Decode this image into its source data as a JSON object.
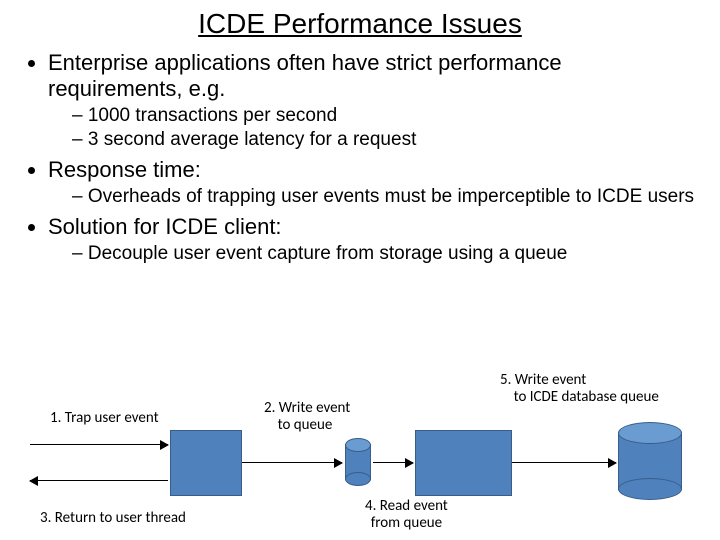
{
  "title": "ICDE Performance Issues",
  "bullets": {
    "b1": "Enterprise applications often have strict performance requirements, e.g.",
    "b1_1": "1000 transactions per second",
    "b1_2": "3 second average latency for a request",
    "b2": "Response time:",
    "b2_1": "Overheads of trapping user events must be imperceptible to ICDE users",
    "b3": "Solution for ICDE client:",
    "b3_1": "Decouple user event capture from storage using a queue"
  },
  "diagram": {
    "step1": "1. Trap user event",
    "step2_line1": "2. Write event",
    "step2_line2": "to queue",
    "step3": "3. Return to user thread",
    "step4_line1": "4. Read event",
    "step4_line2": "from queue",
    "step5_line1": "5. Write event",
    "step5_line2": "to ICDE database queue"
  }
}
